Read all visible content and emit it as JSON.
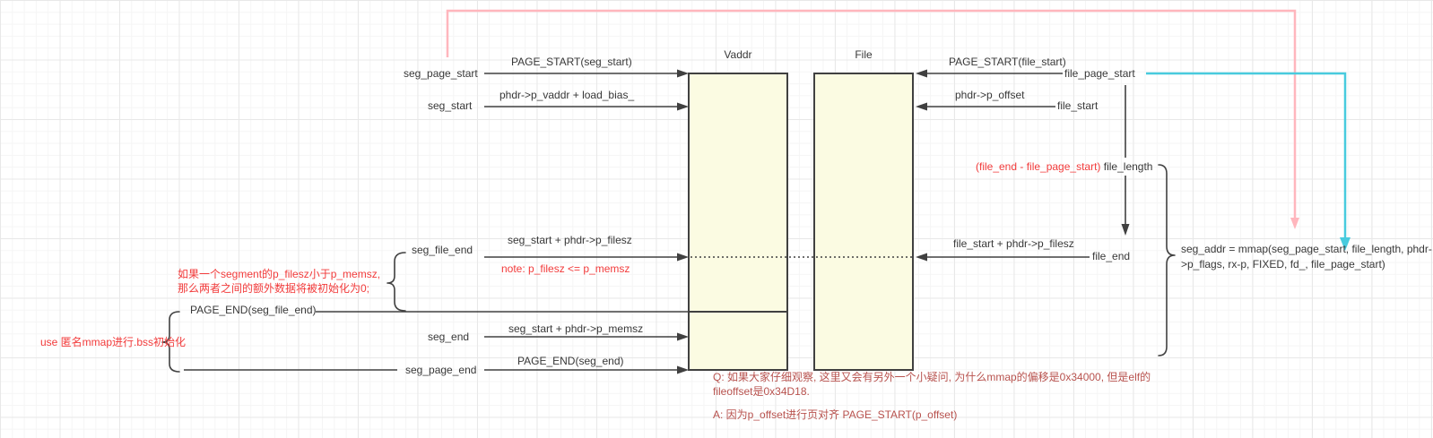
{
  "header": {
    "vaddr": "Vaddr",
    "file": "File"
  },
  "left": {
    "seg_page_start": "seg_page_start",
    "page_start_seg_start": "PAGE_START(seg_start)",
    "seg_start": "seg_start",
    "vaddr_formula": "phdr->p_vaddr + load_bias_",
    "seg_file_end": "seg_file_end",
    "filesz_formula": "seg_start + phdr->p_filesz",
    "note": "note: p_filesz <= p_memsz",
    "page_end_seg_file_end": "PAGE_END(seg_file_end)",
    "seg_end": "seg_end",
    "memsz_formula": "seg_start + phdr->p_memsz",
    "page_end_seg_end": "PAGE_END(seg_end)",
    "seg_page_end": "seg_page_end"
  },
  "right": {
    "file_page_start": "file_page_start",
    "page_start_file_start": "PAGE_START(file_start)",
    "offset_formula": "phdr->p_offset",
    "file_start": "file_start",
    "file_length_formula": "(file_end - file_page_start)",
    "file_length": "file_length",
    "filesz_formula": "file_start + phdr->p_filesz",
    "file_end": "file_end",
    "mmap_line1": "seg_addr = mmap(seg_page_start, file_length, phdr-",
    "mmap_line2": ">p_flags, rx-p, FIXED, fd_, file_page_start)"
  },
  "annotations": {
    "filesz_note_line1": "如果一个segment的p_filesz小于p_memsz,",
    "filesz_note_line2": "那么两者之间的额外数据将被初始化为0;",
    "anon_mmap_note": "use 匿名mmap进行.bss初始化",
    "q_line1": "Q: 如果大家仔细观察, 这里又会有另外一个小疑问, 为什么mmap的偏移是0x34000, 但是elf的",
    "q_line2": "fileoffset是0x34D18.",
    "a_line": "A: 因为p_offset进行页对齐 PAGE_START(p_offset)"
  },
  "colors": {
    "box_fill": "#fbfbe2",
    "stroke": "#404040",
    "red_bright": "#f23b3b",
    "red_dark": "#b8524e",
    "pink": "#ffb6bd",
    "cyan": "#48cbde"
  }
}
